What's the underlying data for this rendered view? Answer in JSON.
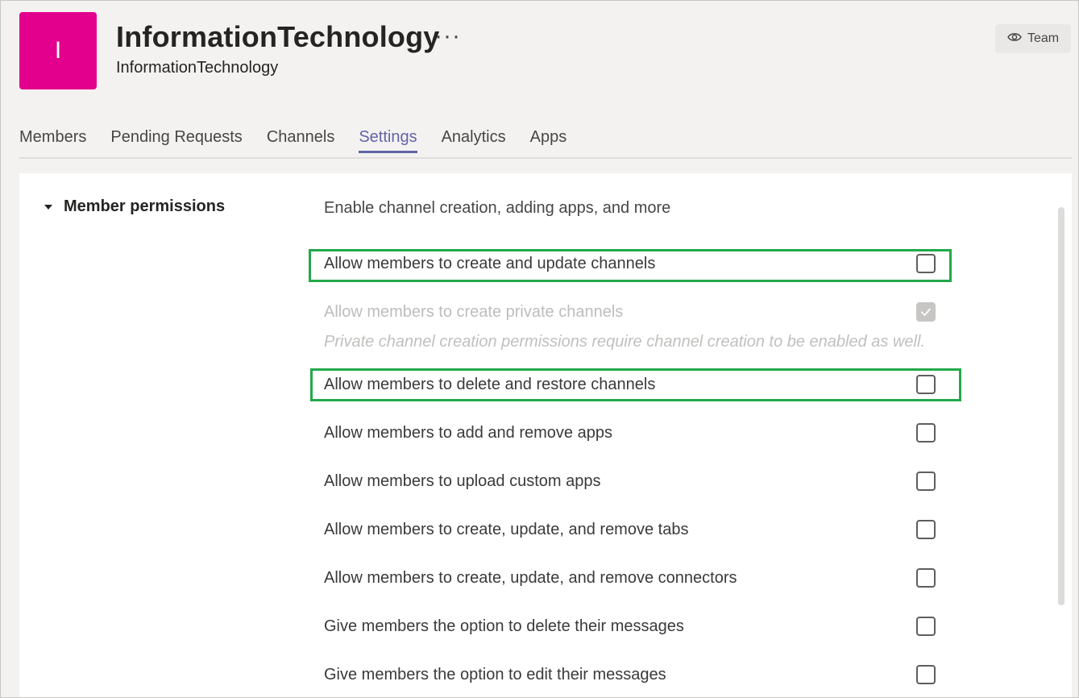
{
  "header": {
    "avatar_letter": "I",
    "title": "InformationTechnology",
    "more": "···",
    "subtitle": "InformationTechnology",
    "badge_label": "Team",
    "badge_icon": "eye-icon"
  },
  "tabs": [
    {
      "label": "Members"
    },
    {
      "label": "Pending Requests"
    },
    {
      "label": "Channels"
    },
    {
      "label": "Settings",
      "active": true
    },
    {
      "label": "Analytics"
    },
    {
      "label": "Apps"
    }
  ],
  "section": {
    "title": "Member permissions",
    "description": "Enable channel creation, adding apps, and more",
    "hint": "Private channel creation permissions require channel creation to be enabled as well.",
    "options": [
      {
        "label": "Allow members to create and update channels",
        "checked": false
      },
      {
        "label": "Allow members to create private channels",
        "checked": true,
        "disabled": true
      },
      {
        "label": "Allow members to delete and restore channels",
        "checked": false
      },
      {
        "label": "Allow members to add and remove apps",
        "checked": false
      },
      {
        "label": "Allow members to upload custom apps",
        "checked": false
      },
      {
        "label": "Allow members to create, update, and remove tabs",
        "checked": false
      },
      {
        "label": "Allow members to create, update, and remove connectors",
        "checked": false
      },
      {
        "label": "Give members the option to delete their messages",
        "checked": false
      },
      {
        "label": "Give members the option to edit their messages",
        "checked": false
      }
    ]
  },
  "colors": {
    "avatar": "#e3008c",
    "accent": "#6264a7",
    "highlight": "#22a94a"
  }
}
